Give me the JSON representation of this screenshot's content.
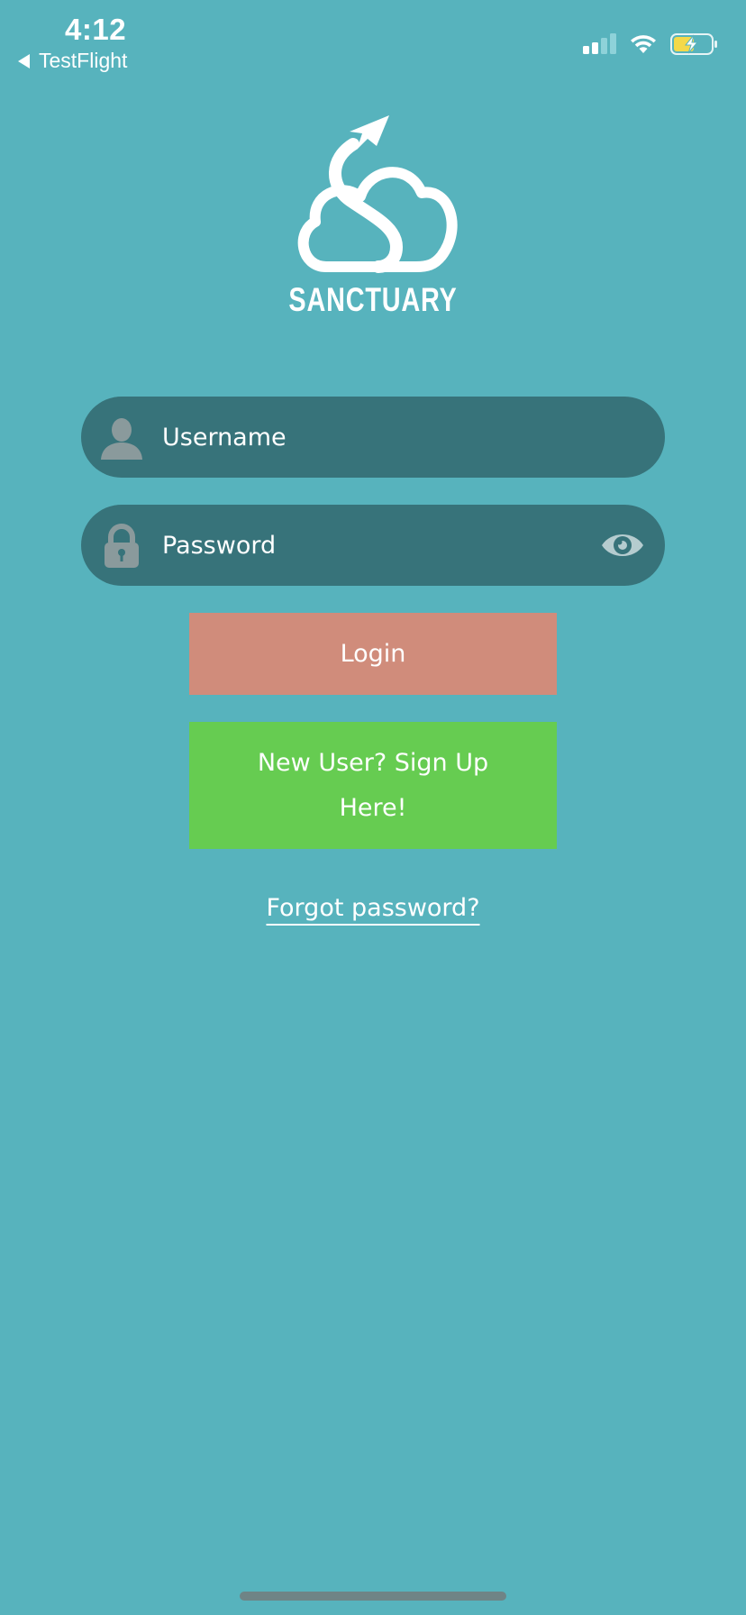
{
  "status_bar": {
    "time": "4:12",
    "back_app": "TestFlight",
    "icons": [
      "signal-icon",
      "wifi-icon",
      "battery-charging-icon"
    ]
  },
  "logo": {
    "wordmark": "SANCTUARY"
  },
  "form": {
    "username_placeholder": "Username",
    "password_placeholder": "Password",
    "login_label": "Login",
    "signup_label": "New User? Sign Up Here!",
    "forgot_label": "Forgot password?"
  },
  "colors": {
    "background": "#57b3bd",
    "field_background": "#37737a",
    "field_icon": "#8a9a9c",
    "login_button": "#d08c7b",
    "signup_button": "#66cc51",
    "battery_fill": "#f4d94a",
    "home_indicator": "#6f8486"
  }
}
